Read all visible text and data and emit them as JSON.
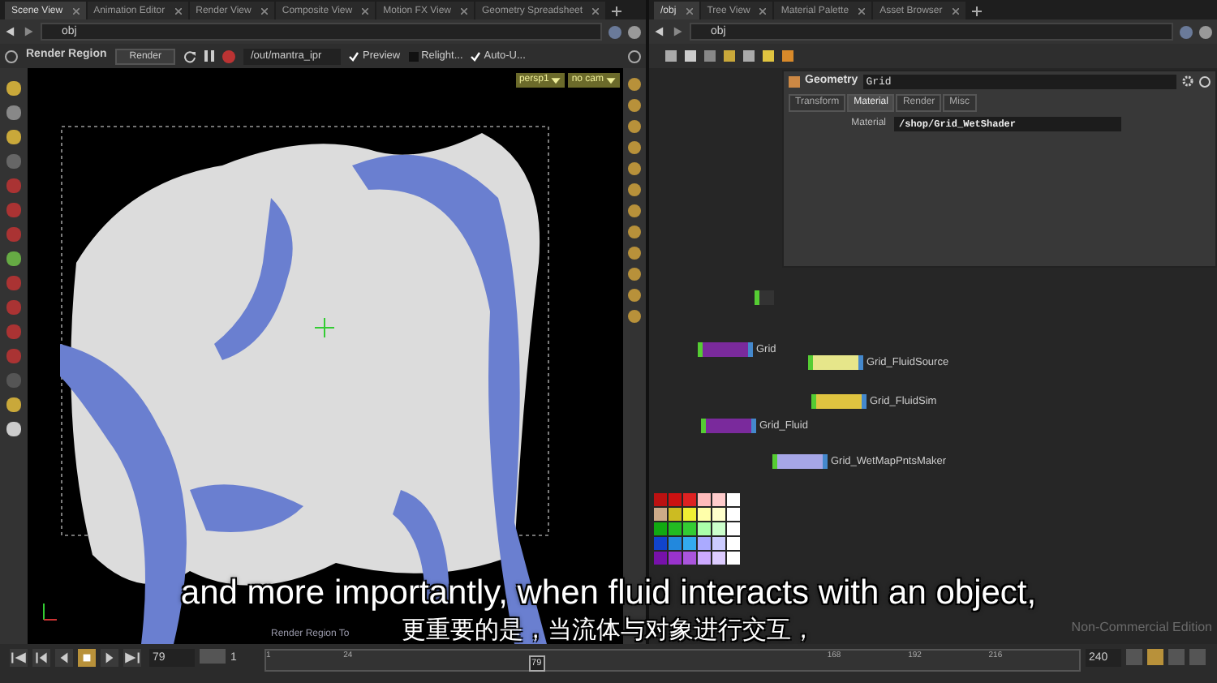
{
  "left_pane": {
    "tabs": [
      {
        "label": "Scene View",
        "selected": true
      },
      {
        "label": "Animation Editor",
        "selected": false
      },
      {
        "label": "Render View",
        "selected": false
      },
      {
        "label": "Composite View",
        "selected": false
      },
      {
        "label": "Motion FX View",
        "selected": false
      },
      {
        "label": "Geometry Spreadsheet",
        "selected": false
      }
    ],
    "path": "obj",
    "toolbar": {
      "title": "Render Region",
      "render_button": "Render",
      "rop": "/out/mantra_ipr",
      "options": [
        {
          "label": "Preview",
          "checked": true
        },
        {
          "label": "Relight...",
          "checked": false
        },
        {
          "label": "Auto-U...",
          "checked": true
        }
      ]
    },
    "viewport": {
      "camera": "persp1",
      "cam_menu": "no cam",
      "hint": "Render Region To"
    }
  },
  "right_pane": {
    "tabs": [
      {
        "label": "/obj",
        "selected": true
      },
      {
        "label": "Tree View",
        "selected": false
      },
      {
        "label": "Material Palette",
        "selected": false
      },
      {
        "label": "Asset Browser",
        "selected": false
      }
    ],
    "path": "obj",
    "parameters": {
      "type": "Geometry",
      "name": "Grid",
      "tabs": [
        {
          "label": "Transform",
          "selected": false
        },
        {
          "label": "Material",
          "selected": true
        },
        {
          "label": "Render",
          "selected": false
        },
        {
          "label": "Misc",
          "selected": false
        }
      ],
      "fields": [
        {
          "label": "Material",
          "value": "/shop/Grid_WetShader"
        }
      ]
    },
    "nodes": [
      {
        "label": "Grid",
        "color": "#7a2a9c"
      },
      {
        "label": "Grid_FluidSource",
        "color": "#e6e68a"
      },
      {
        "label": "Grid_FluidSim",
        "color": "#e0c440"
      },
      {
        "label": "Grid_Fluid",
        "color": "#7a2a9c"
      },
      {
        "label": "Grid_WetMapPntsMaker",
        "color": "#a6a6e6"
      }
    ],
    "edition": "Non-Commercial Edition"
  },
  "timeline": {
    "frame": "79",
    "start": "1",
    "end": "240",
    "ticks": [
      "1",
      "24",
      "168",
      "192",
      "216"
    ],
    "marker": "79"
  },
  "subtitles": {
    "english": "and more importantly, when fluid interacts with an object,",
    "chinese": "更重要的是，当流体与对象进行交互，"
  }
}
